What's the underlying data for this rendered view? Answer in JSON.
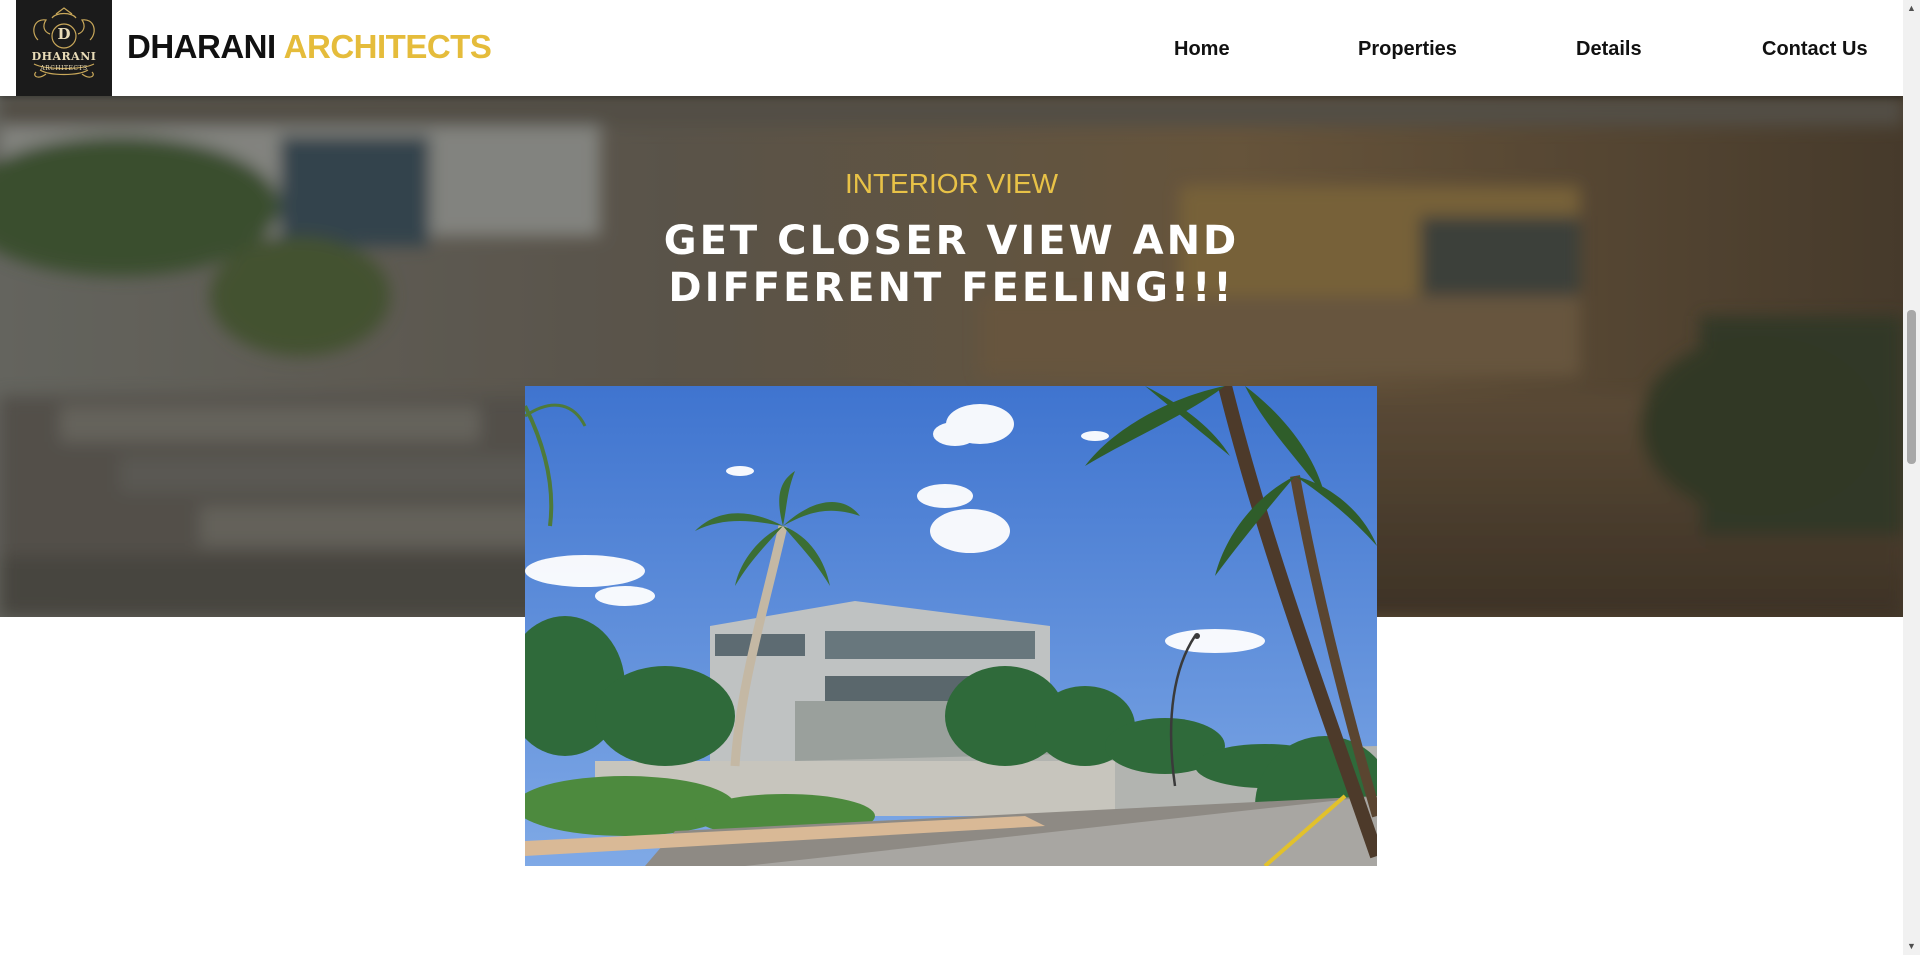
{
  "header": {
    "logo": {
      "initial": "D",
      "name": "DHARANI",
      "sub": "ARCHITECTS"
    },
    "brand_primary": "DHARANI",
    "brand_accent": "ARCHITECTS",
    "nav": [
      {
        "label": "Home"
      },
      {
        "label": "Properties"
      },
      {
        "label": "Details"
      },
      {
        "label": "Contact Us"
      }
    ]
  },
  "hero": {
    "eyebrow": "INTERIOR VIEW",
    "title_line1": "GET CLOSER VIEW AND",
    "title_line2": "DIFFERENT FEELING!!!"
  },
  "colors": {
    "accent": "#e5bc3b",
    "logo_bg": "#1b1b1b",
    "nav_text": "#111111"
  }
}
